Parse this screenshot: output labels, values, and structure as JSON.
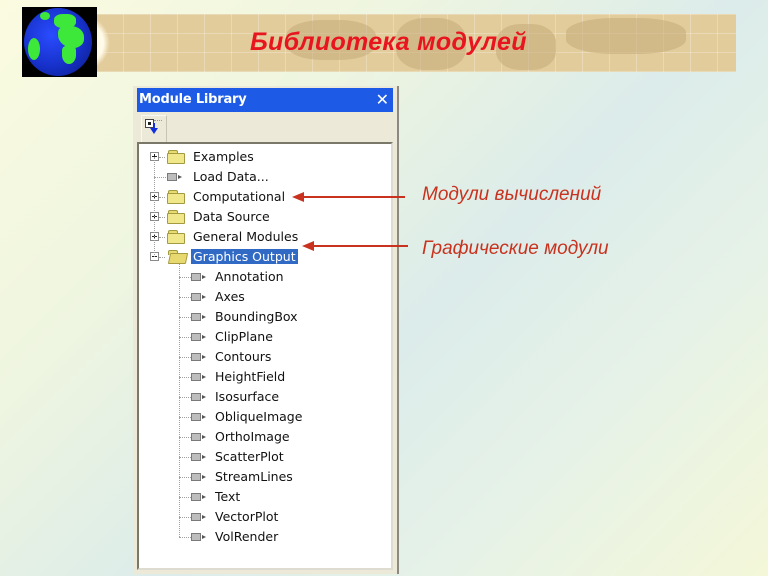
{
  "slide": {
    "title": "Библиотека модулей",
    "title_color": "#e8141e",
    "logo_icon": "globe-icon"
  },
  "window": {
    "title": "Module Library",
    "titlebar_color": "#1d5be6",
    "close_label": "✕",
    "toolbar": {
      "expand_button_icon": "expand-tree-icon"
    },
    "tree": [
      {
        "label": "Examples",
        "type": "folder",
        "expander": "plus",
        "level": 0
      },
      {
        "label": "Load Data...",
        "type": "module",
        "expander": "none",
        "level": 0
      },
      {
        "label": "Computational",
        "type": "folder",
        "expander": "plus",
        "level": 0
      },
      {
        "label": "Data Source",
        "type": "folder",
        "expander": "plus",
        "level": 0
      },
      {
        "label": "General Modules",
        "type": "folder",
        "expander": "plus",
        "level": 0
      },
      {
        "label": "Graphics Output",
        "type": "folder-open",
        "expander": "minus",
        "level": 0,
        "selected": true
      },
      {
        "label": "Annotation",
        "type": "module",
        "level": 1
      },
      {
        "label": "Axes",
        "type": "module",
        "level": 1
      },
      {
        "label": "BoundingBox",
        "type": "module",
        "level": 1
      },
      {
        "label": "ClipPlane",
        "type": "module",
        "level": 1
      },
      {
        "label": "Contours",
        "type": "module",
        "level": 1
      },
      {
        "label": "HeightField",
        "type": "module",
        "level": 1
      },
      {
        "label": "Isosurface",
        "type": "module",
        "level": 1
      },
      {
        "label": "ObliqueImage",
        "type": "module",
        "level": 1
      },
      {
        "label": "OrthoImage",
        "type": "module",
        "level": 1
      },
      {
        "label": "ScatterPlot",
        "type": "module",
        "level": 1
      },
      {
        "label": "StreamLines",
        "type": "module",
        "level": 1
      },
      {
        "label": "Text",
        "type": "module",
        "level": 1
      },
      {
        "label": "VectorPlot",
        "type": "module",
        "level": 1
      },
      {
        "label": "VolRender",
        "type": "module",
        "level": 1
      }
    ]
  },
  "annotations": [
    {
      "text": "Модули вычислений",
      "points_to": "Computational"
    },
    {
      "text": "Графические модули",
      "points_to": "Graphics Output"
    }
  ],
  "annotation_color": "#c8321e"
}
